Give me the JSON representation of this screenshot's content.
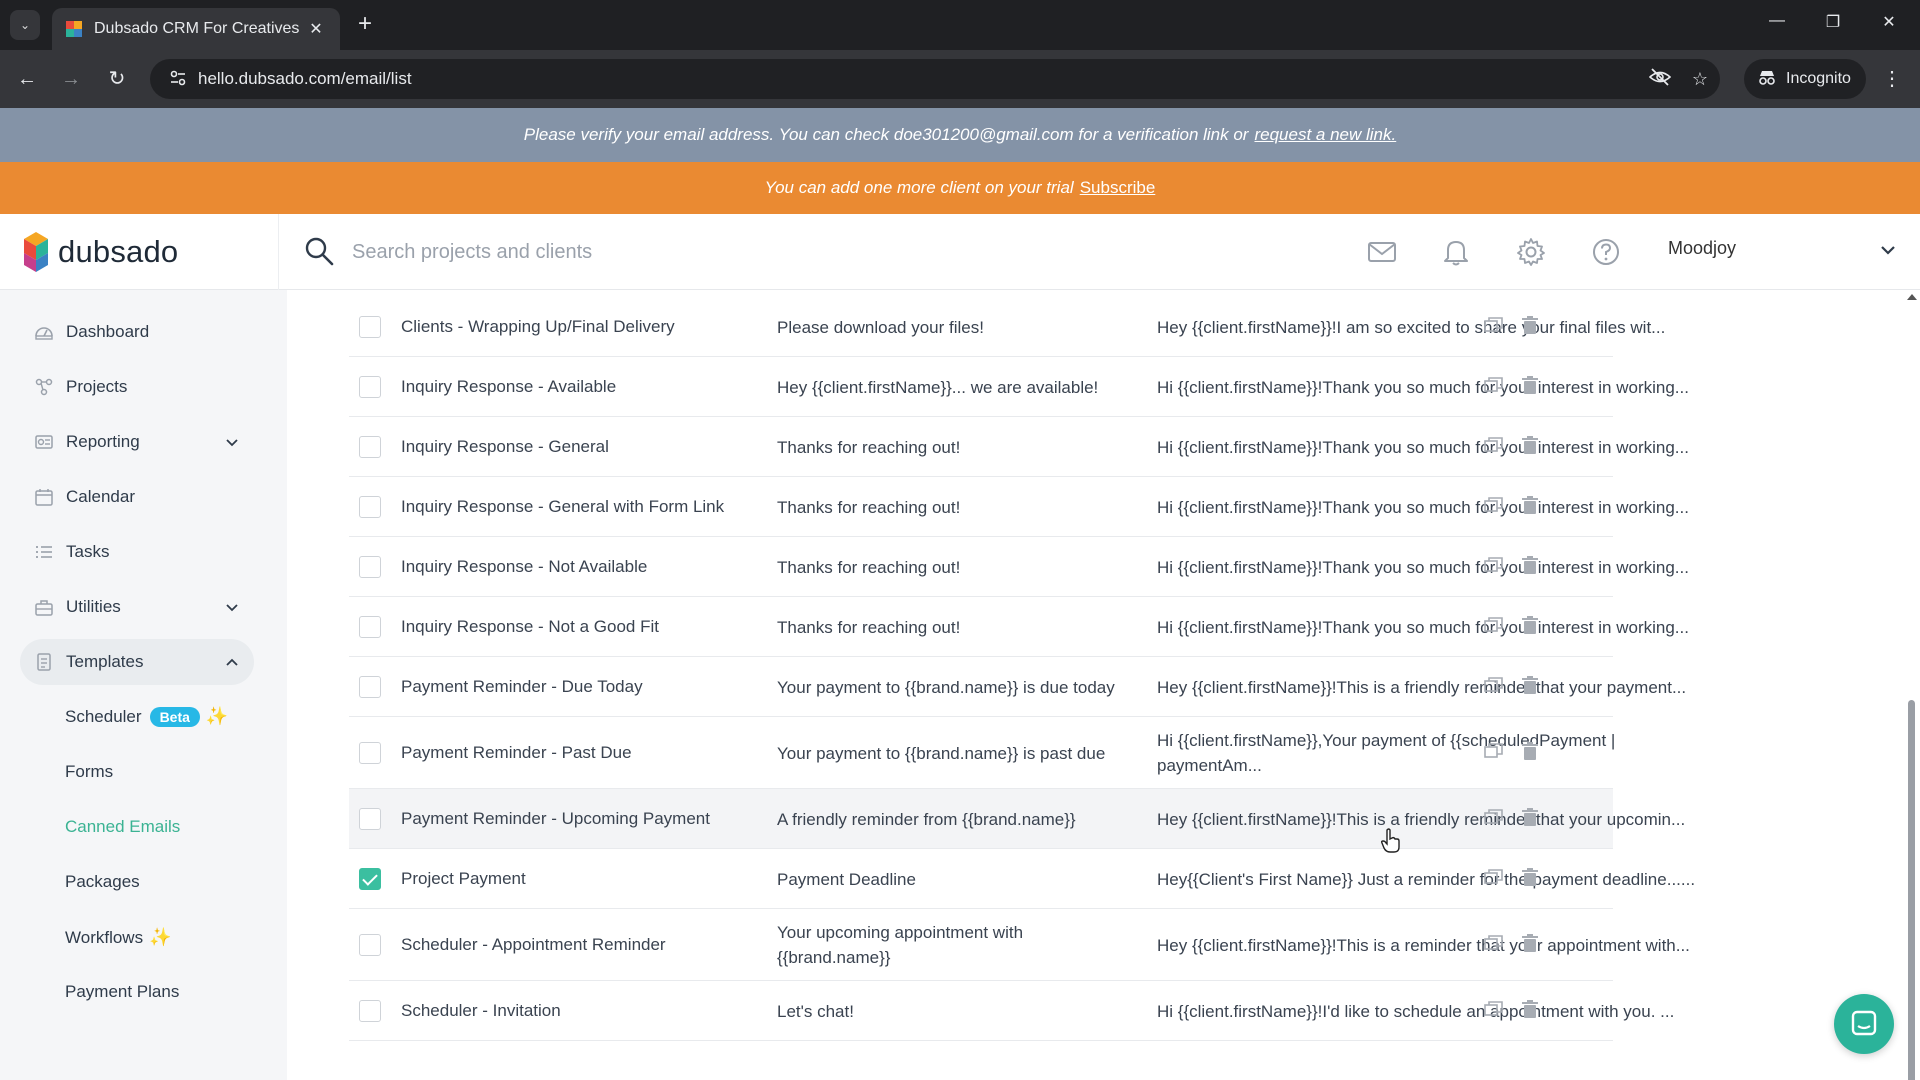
{
  "browser": {
    "tab_title": "Dubsado CRM For Creatives",
    "tab_close": "✕",
    "new_tab": "+",
    "url": "hello.dubsado.com/email/list",
    "incognito_label": "Incognito",
    "controls": {
      "minimize": "—",
      "restore": "❐",
      "close": "✕",
      "back": "←",
      "forward": "→",
      "reload": "↻",
      "menu": "⋮",
      "tab_list": "⌄",
      "star": "☆"
    }
  },
  "verify_banner": {
    "text": "Please verify your email address. You can check doe301200@gmail.com for a verification link or",
    "link": "request a new link."
  },
  "trial_banner": {
    "text": "You can add one more client on your trial",
    "link": "Subscribe"
  },
  "header": {
    "logo_text": "dubsado",
    "search_placeholder": "Search projects and clients",
    "account_name": "Moodjoy",
    "icons": [
      "mail-icon",
      "bell-icon",
      "gear-icon",
      "help-icon"
    ]
  },
  "sidebar": {
    "items": [
      {
        "label": "Dashboard",
        "icon": "dashboard-icon"
      },
      {
        "label": "Projects",
        "icon": "projects-icon"
      },
      {
        "label": "Reporting",
        "icon": "reporting-icon",
        "expandable": true
      },
      {
        "label": "Calendar",
        "icon": "calendar-icon"
      },
      {
        "label": "Tasks",
        "icon": "tasks-icon"
      },
      {
        "label": "Utilities",
        "icon": "utilities-icon",
        "expandable": true
      },
      {
        "label": "Templates",
        "icon": "templates-icon",
        "expanded": true
      }
    ],
    "sub_items": [
      {
        "label": "Scheduler",
        "badge": "Beta",
        "sparkle": "✨"
      },
      {
        "label": "Forms"
      },
      {
        "label": "Canned Emails",
        "current": true
      },
      {
        "label": "Packages"
      },
      {
        "label": "Workflows",
        "sparkle": "✨"
      },
      {
        "label": "Payment Plans"
      }
    ]
  },
  "email_list": {
    "rows": [
      {
        "name": "Clients - Wrapping Up/Final Delivery",
        "subject": "Please download your files!",
        "body": "Hey {{client.firstName}}!I am so excited to share your final files wit...",
        "checked": false
      },
      {
        "name": "Inquiry Response - Available",
        "subject": "Hey {{client.firstName}}... we are available!",
        "body": "Hi {{client.firstName}}!Thank you so much for your interest in working...",
        "checked": false
      },
      {
        "name": "Inquiry Response - General",
        "subject": "Thanks for reaching out!",
        "body": "Hi {{client.firstName}}!Thank you so much for your interest in working...",
        "checked": false
      },
      {
        "name": "Inquiry Response - General with Form Link",
        "subject": "Thanks for reaching out!",
        "body": "Hi {{client.firstName}}!Thank you so much for your interest in working...",
        "checked": false
      },
      {
        "name": "Inquiry Response - Not Available",
        "subject": "Thanks for reaching out!",
        "body": "Hi {{client.firstName}}!Thank you so much for your interest in working...",
        "checked": false
      },
      {
        "name": "Inquiry Response - Not a Good Fit",
        "subject": "Thanks for reaching out!",
        "body": "Hi {{client.firstName}}!Thank you so much for your interest in working...",
        "checked": false
      },
      {
        "name": "Payment Reminder - Due Today",
        "subject": "Your payment to {{brand.name}} is due today",
        "body": "Hey {{client.firstName}}!This is a friendly reminder that your payment...",
        "checked": false
      },
      {
        "name": "Payment Reminder - Past Due",
        "subject": "Your payment to {{brand.name}} is past due",
        "body": "Hi {{client.firstName}},Your payment of {{scheduledPayment | paymentAm...",
        "checked": false
      },
      {
        "name": "Payment Reminder - Upcoming Payment",
        "subject": "A friendly reminder from {{brand.name}}",
        "body": "Hey {{client.firstName}}!This is a friendly reminder that your upcomin...",
        "checked": false,
        "hover": true
      },
      {
        "name": "Project Payment",
        "subject": "Payment Deadline",
        "body": "Hey{{Client's First Name}} Just a reminder for the payment deadline......",
        "checked": true
      },
      {
        "name": "Scheduler - Appointment Reminder",
        "subject": "Your upcoming appointment with {{brand.name}}",
        "body": "Hey {{client.firstName}}!This is a reminder that your appointment with...",
        "checked": false
      },
      {
        "name": "Scheduler - Invitation",
        "subject": "Let's chat!",
        "body": "Hi {{client.firstName}}!I'd like to schedule an appointment with you. ...",
        "checked": false
      }
    ],
    "row_action_icons": [
      "duplicate-icon",
      "trash-icon"
    ]
  },
  "colors": {
    "accent": "#3bbfa0",
    "verify_banner": "#8493a7",
    "trial_banner": "#ea8a32",
    "beta_badge": "#27b8e6",
    "current_nav": "#3bb393"
  }
}
